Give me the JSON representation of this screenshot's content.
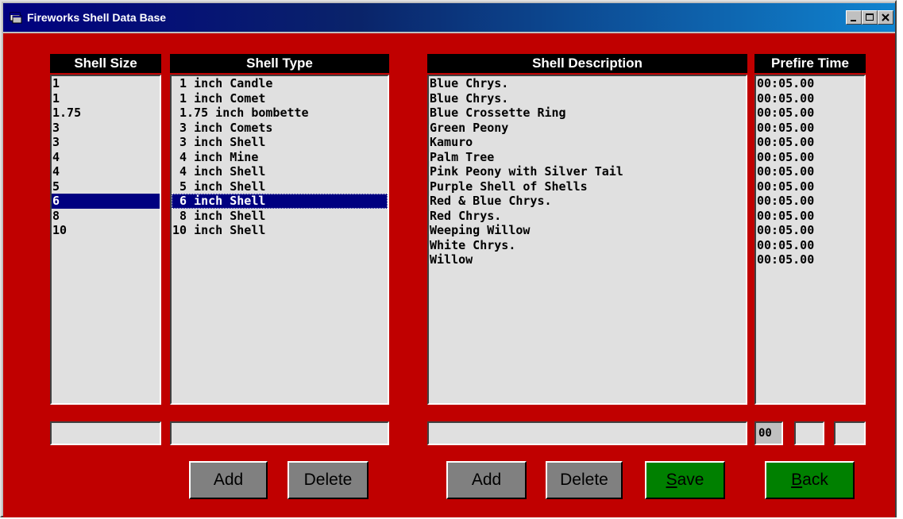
{
  "window": {
    "title": "Fireworks Shell Data Base"
  },
  "colors": {
    "client_bg": "#c00000",
    "list_bg": "#e0e0e0",
    "header_bg": "#000000",
    "selection": "#000080",
    "gray_button": "#808080",
    "green_button": "#008000"
  },
  "headers": {
    "shell_size": "Shell Size",
    "shell_type": "Shell Type",
    "shell_description": "Shell Description",
    "prefire_time": "Prefire Time"
  },
  "lists": {
    "shell_size": [
      "1",
      "1",
      "1.75",
      "3",
      "3",
      "4",
      "4",
      "5",
      "6",
      "8",
      "10"
    ],
    "shell_type": [
      " 1 inch Candle",
      " 1 inch Comet",
      " 1.75 inch bombette",
      " 3 inch Comets",
      " 3 inch Shell",
      " 4 inch Mine",
      " 4 inch Shell",
      " 5 inch Shell",
      " 6 inch Shell",
      " 8 inch Shell",
      "10 inch Shell"
    ],
    "shell_description": [
      "Blue Chrys.",
      "Blue Chrys.",
      "Blue Crossette Ring",
      "Green Peony",
      "Kamuro",
      "Palm Tree",
      "Pink Peony with Silver Tail",
      "Purple Shell of Shells",
      "Red & Blue Chrys.",
      "Red Chrys.",
      "Weeping Willow",
      "White Chrys.",
      "Willow"
    ],
    "prefire_time": [
      "00:05.00",
      "00:05.00",
      "00:05.00",
      "00:05.00",
      "00:05.00",
      "00:05.00",
      "00:05.00",
      "00:05.00",
      "00:05.00",
      "00:05.00",
      "00:05.00",
      "00:05.00",
      "00:05.00"
    ],
    "selected_index": 8
  },
  "inputs": {
    "shell_size": "",
    "shell_type": "",
    "shell_description": "",
    "prefire_minutes": "00",
    "prefire_seconds": "",
    "prefire_hundredths": ""
  },
  "buttons": {
    "type_add": "Add",
    "type_delete": "Delete",
    "desc_add": "Add",
    "desc_delete": "Delete",
    "save_underline": "S",
    "save_rest": "ave",
    "back_underline": "B",
    "back_rest": "ack"
  }
}
